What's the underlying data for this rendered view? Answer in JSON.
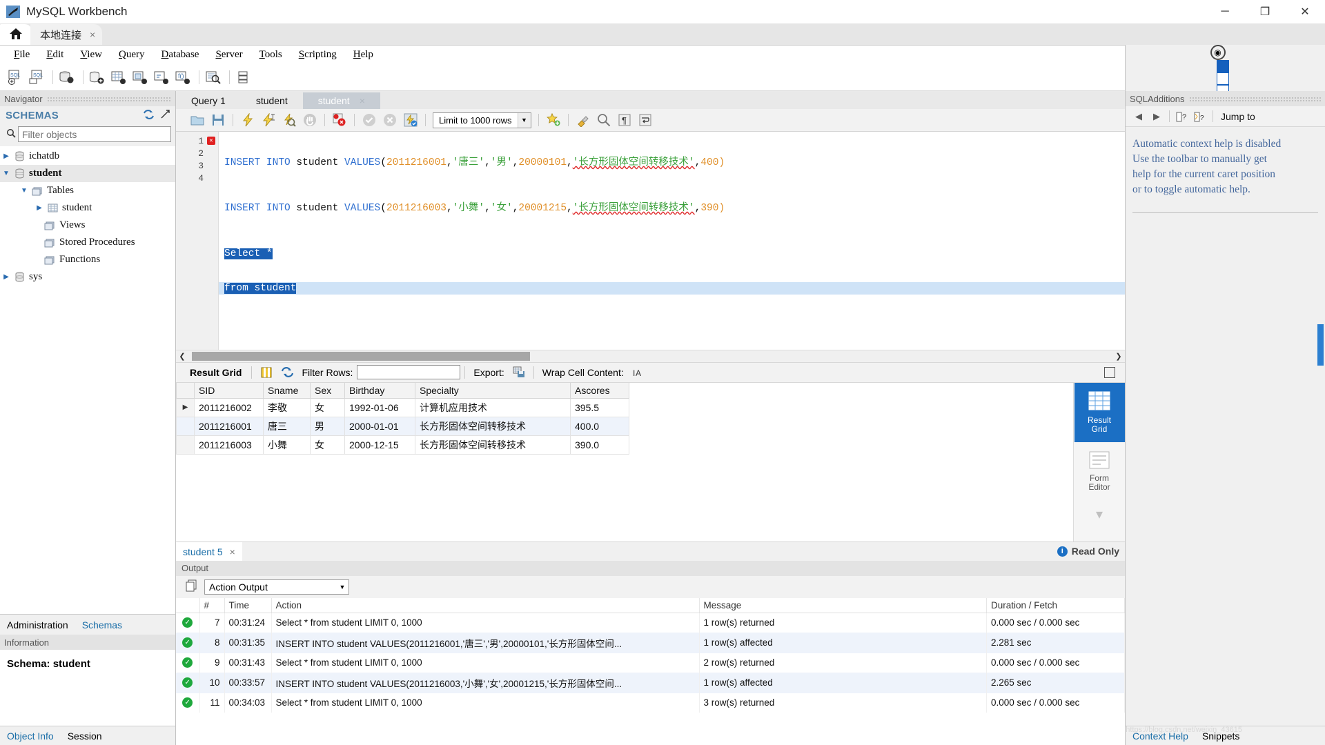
{
  "window": {
    "title": "MySQL Workbench",
    "minimize": "─",
    "maximize": "❐",
    "close": "✕"
  },
  "connection_tab": {
    "label": "本地连接",
    "close": "×"
  },
  "menu": [
    {
      "label": "File",
      "accel": "F"
    },
    {
      "label": "Edit",
      "accel": "E"
    },
    {
      "label": "View",
      "accel": "V"
    },
    {
      "label": "Query",
      "accel": "Q"
    },
    {
      "label": "Database",
      "accel": "D"
    },
    {
      "label": "Server",
      "accel": "S"
    },
    {
      "label": "Tools",
      "accel": "T"
    },
    {
      "label": "Scripting",
      "accel": "S"
    },
    {
      "label": "Help",
      "accel": "H"
    }
  ],
  "navigator": {
    "panel_title": "Navigator",
    "schemas_title": "SCHEMAS",
    "filter_placeholder": "Filter objects",
    "tree": [
      {
        "label": "ichatdb",
        "indent": 0,
        "arrow": "▶",
        "icon": "database-icon",
        "selected": false
      },
      {
        "label": "student",
        "indent": 0,
        "arrow": "▼",
        "icon": "database-icon",
        "selected": true
      },
      {
        "label": "Tables",
        "indent": 1,
        "arrow": "▼",
        "icon": "folder-icon",
        "selected": false
      },
      {
        "label": "student",
        "indent": 2,
        "arrow": "▶",
        "icon": "table-icon",
        "selected": false
      },
      {
        "label": "Views",
        "indent": 1,
        "arrow": "",
        "icon": "folder-icon",
        "selected": false
      },
      {
        "label": "Stored Procedures",
        "indent": 1,
        "arrow": "",
        "icon": "folder-icon",
        "selected": false
      },
      {
        "label": "Functions",
        "indent": 1,
        "arrow": "",
        "icon": "folder-icon",
        "selected": false
      },
      {
        "label": "sys",
        "indent": 0,
        "arrow": "▶",
        "icon": "database-icon",
        "selected": false
      }
    ],
    "bottom_tabs": [
      {
        "label": "Administration",
        "active": false
      },
      {
        "label": "Schemas",
        "active": true
      }
    ],
    "information_title": "Information",
    "schema_line": "Schema: student",
    "object_tabs": [
      {
        "label": "Object Info",
        "active": false
      },
      {
        "label": "Session",
        "active": true
      }
    ]
  },
  "editor": {
    "tabs": [
      {
        "label": "Query 1",
        "active": false,
        "closable": false
      },
      {
        "label": "student",
        "active": false,
        "closable": false
      },
      {
        "label": "student",
        "active": true,
        "closable": true
      }
    ],
    "close_glyph": "×",
    "limit_label": "Limit to 1000 rows",
    "toolbar_icons": [
      "open-script-icon",
      "save-script-icon",
      "execute-icon",
      "execute-current-icon",
      "explain-icon",
      "stop-icon",
      "toggle-stop-on-error-icon",
      "commit-icon",
      "rollback-icon",
      "autocommit-icon"
    ],
    "toolbar_icons_right": [
      "bookmark-icon",
      "beautify-icon",
      "find-icon",
      "paragraph-icon",
      "wrap-icon"
    ],
    "lines": [
      {
        "no": "1",
        "error": true,
        "selected": false
      },
      {
        "no": "2",
        "error": false,
        "selected": false
      },
      {
        "no": "3",
        "error": false,
        "selected": true
      },
      {
        "no": "4",
        "error": false,
        "selected": true
      }
    ],
    "code": {
      "l1": {
        "kw": "INSERT INTO",
        "tbl": " student ",
        "vals": "VALUES",
        "p1": "(",
        "n1": "2011216001",
        "c1": ",",
        "s1": "'唐三'",
        "c2": ",",
        "s2": "'男'",
        "c3": ",",
        "n2": "20000101",
        "c4": ",",
        "s3": "'长方形固体空间转移技术'",
        "c5": ",",
        "n3": "400",
        "p2": ")"
      },
      "l2": {
        "kw": "INSERT INTO",
        "tbl": " student ",
        "vals": "VALUES",
        "p1": "(",
        "n1": "2011216003",
        "c1": ",",
        "s1": "'小舞'",
        "c2": ",",
        "s2": "'女'",
        "c3": ",",
        "n2": "20001215",
        "c4": ",",
        "s3": "'长方形固体空间转移技术'",
        "c5": ",",
        "n3": "390",
        "p2": ")"
      },
      "l3": "Select *",
      "l4": "from student"
    }
  },
  "results": {
    "toolbar": {
      "result_grid_label": "Result Grid",
      "filter_label": "Filter Rows:",
      "filter_value": "",
      "export_label": "Export:",
      "wrap_label": "Wrap Cell Content:",
      "wrap_glyph": "ᴵA"
    },
    "columns": [
      "SID",
      "Sname",
      "Sex",
      "Birthday",
      "Specialty",
      "Ascores"
    ],
    "rows": [
      {
        "marker": "▶",
        "SID": "2011216002",
        "Sname": "李敬",
        "Sex": "女",
        "Birthday": "1992-01-06",
        "Specialty": "计算机应用技术",
        "Ascores": "395.5"
      },
      {
        "marker": "",
        "SID": "2011216001",
        "Sname": "唐三",
        "Sex": "男",
        "Birthday": "2000-01-01",
        "Specialty": "长方形固体空间转移技术",
        "Ascores": "400.0"
      },
      {
        "marker": "",
        "SID": "2011216003",
        "Sname": "小舞",
        "Sex": "女",
        "Birthday": "2000-12-15",
        "Specialty": "长方形固体空间转移技术",
        "Ascores": "390.0"
      }
    ],
    "side_panel": [
      {
        "label": "Result\nGrid",
        "line1": "Result",
        "line2": "Grid",
        "active": true,
        "icon": "grid-icon"
      },
      {
        "label": "Form\nEditor",
        "line1": "Form",
        "line2": "Editor",
        "active": false,
        "icon": "form-icon"
      }
    ],
    "footer": {
      "tab_label": "student 5",
      "tab_close": "×",
      "read_only": "Read Only",
      "info_glyph": "i"
    }
  },
  "output": {
    "panel_title": "Output",
    "selector_value": "Action Output",
    "columns": [
      "",
      "#",
      "Time",
      "Action",
      "Message",
      "Duration / Fetch"
    ],
    "rows": [
      {
        "status": "ok",
        "num": "7",
        "time": "00:31:24",
        "action": "Select * from student LIMIT 0, 1000",
        "message": "1 row(s) returned",
        "duration": "0.000 sec / 0.000 sec"
      },
      {
        "status": "ok",
        "num": "8",
        "time": "00:31:35",
        "action": "INSERT INTO student VALUES(2011216001,'唐三','男',20000101,'长方形固体空间...",
        "message": "1 row(s) affected",
        "duration": "2.281 sec"
      },
      {
        "status": "ok",
        "num": "9",
        "time": "00:31:43",
        "action": "Select * from student LIMIT 0, 1000",
        "message": "2 row(s) returned",
        "duration": "0.000 sec / 0.000 sec"
      },
      {
        "status": "ok",
        "num": "10",
        "time": "00:33:57",
        "action": "INSERT INTO student VALUES(2011216003,'小舞','女',20001215,'长方形固体空间...",
        "message": "1 row(s) affected",
        "duration": "2.265 sec"
      },
      {
        "status": "ok",
        "num": "11",
        "time": "00:34:03",
        "action": "Select * from student LIMIT 0, 1000",
        "message": "3 row(s) returned",
        "duration": "0.000 sec / 0.000 sec"
      }
    ]
  },
  "sql_additions": {
    "panel_title": "SQLAdditions",
    "jump_to": "Jump to",
    "help_text_lines": [
      "Automatic context help is disabled",
      "Use the toolbar to manually get",
      "help for the current caret position",
      "or to toggle automatic help."
    ],
    "tabs": [
      {
        "label": "Context Help",
        "active": true
      },
      {
        "label": "Snippets",
        "active": false
      }
    ]
  },
  "colors": {
    "accent_blue": "#1b6fc4",
    "keyword": "#2f6fd0",
    "number": "#e08f28",
    "string": "#3aa03a",
    "success": "#1ea83c",
    "error": "#e02020",
    "selection": "#1a5fb4"
  },
  "watermark": "https://blog.csdn.net/weixin_43615"
}
